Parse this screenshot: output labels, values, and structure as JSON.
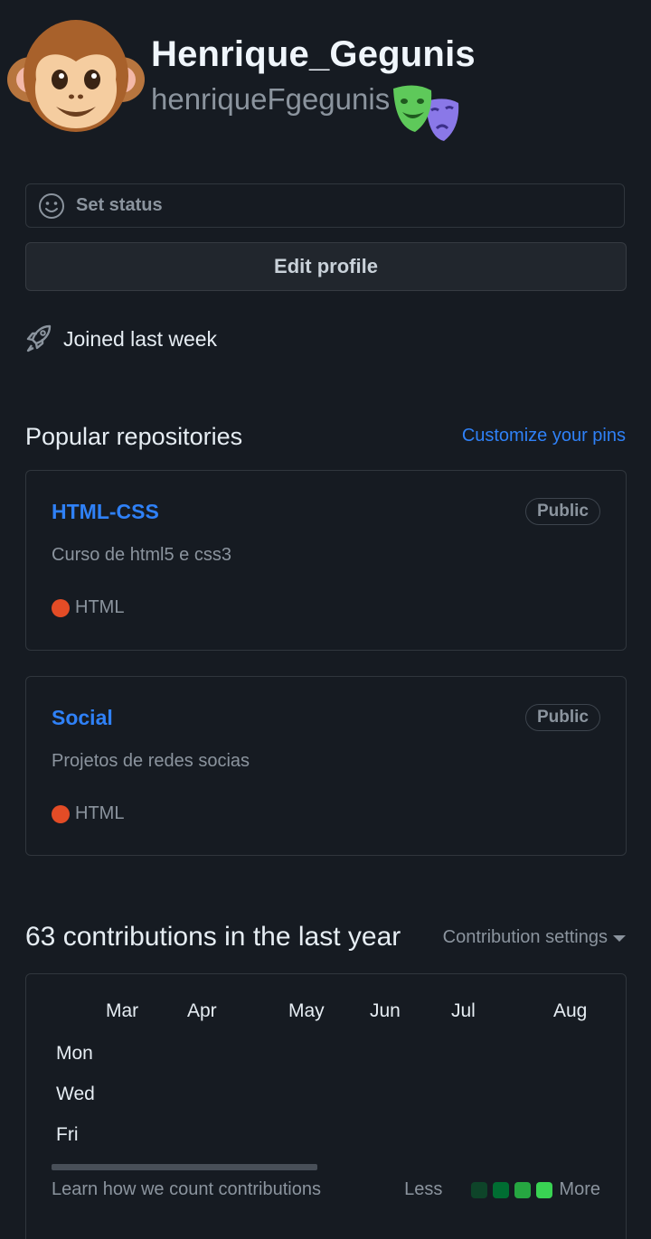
{
  "profile": {
    "display_name": "Henrique_Gegunis",
    "username": "henriqueFgegunis",
    "avatar_icon": "monkey-face-emoji",
    "username_emoji": "performing-arts-masks"
  },
  "status": {
    "label": "Set status",
    "icon": "smiley-icon"
  },
  "edit_profile": {
    "label": "Edit profile"
  },
  "joined": {
    "icon": "rocket-icon",
    "text": "Joined last week"
  },
  "popular": {
    "title": "Popular repositories",
    "customize_link": "Customize your pins",
    "repos": [
      {
        "name": "HTML-CSS",
        "visibility": "Public",
        "description": "Curso de html5 e css3",
        "language": "HTML",
        "language_color": "#e34c26"
      },
      {
        "name": "Social",
        "visibility": "Public",
        "description": "Projetos de redes socias",
        "language": "HTML",
        "language_color": "#e34c26"
      }
    ]
  },
  "contributions": {
    "title": "63 contributions in the last year",
    "settings_label": "Contribution settings",
    "months": [
      "Mar",
      "Apr",
      "May",
      "Jun",
      "Jul",
      "Aug"
    ],
    "days": [
      "Mon",
      "Wed",
      "Fri"
    ],
    "learn_link": "Learn how we count contributions",
    "legend_less": "Less",
    "legend_more": "More",
    "legend_colors": [
      "#0e4429",
      "#006d32",
      "#26a641",
      "#39d353"
    ]
  }
}
